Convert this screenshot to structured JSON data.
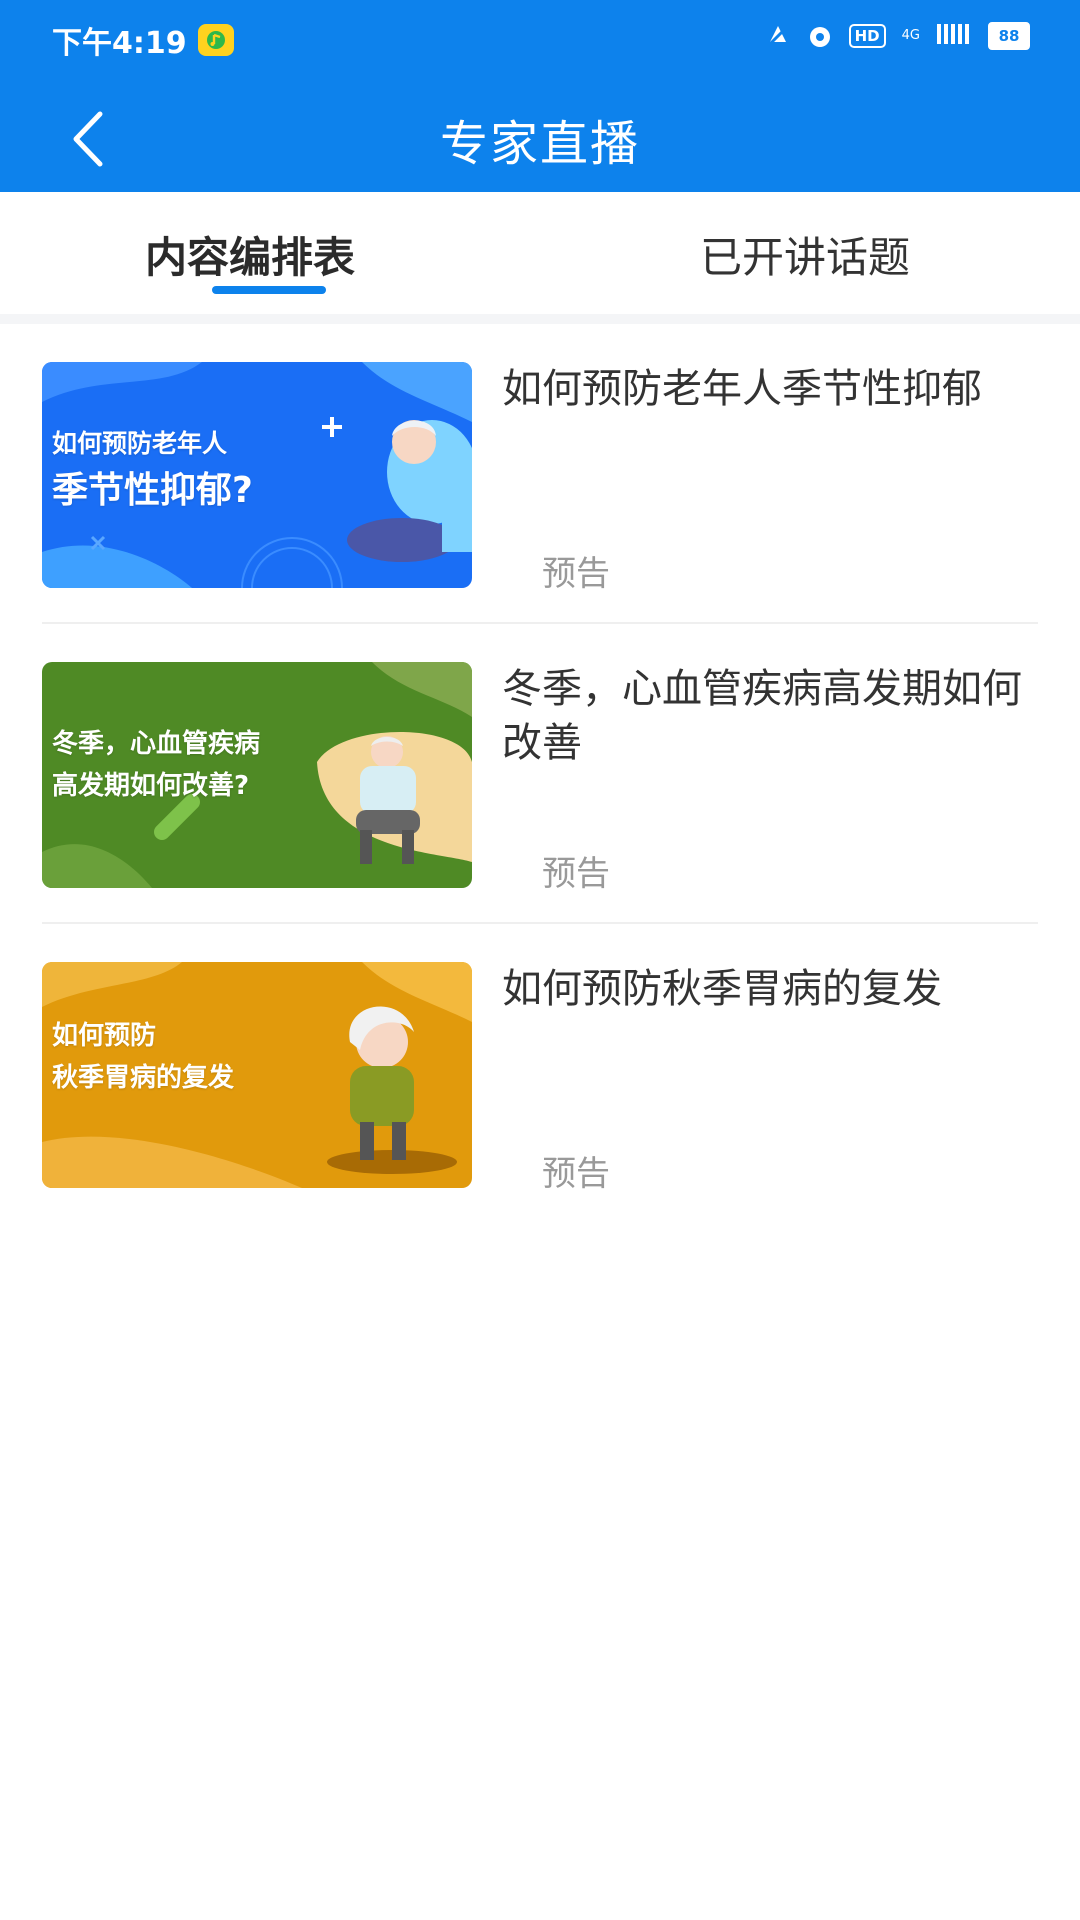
{
  "status_bar": {
    "time": "下午4:19",
    "hd": "HD",
    "network": "4G",
    "battery": "88"
  },
  "nav": {
    "title": "专家直播"
  },
  "tabs": [
    {
      "label": "内容编排表",
      "active": true
    },
    {
      "label": "已开讲话题",
      "active": false
    }
  ],
  "items": [
    {
      "thumb_line1": "如何预防老年人",
      "thumb_line2": "季节性抑郁?",
      "title": "如何预防老年人季节性抑郁",
      "status": "预告",
      "theme_color": "#1a6ef5"
    },
    {
      "thumb_line1": "冬季，心血管疾病",
      "thumb_line2": "高发期如何改善?",
      "title": "冬季，心血管疾病高发期如何改善",
      "status": "预告",
      "theme_color": "#4f8a25"
    },
    {
      "thumb_line1": "如何预防",
      "thumb_line2": "秋季胃病的复发",
      "title": "如何预防秋季胃病的复发",
      "status": "预告",
      "theme_color": "#e19a0c"
    }
  ],
  "colors": {
    "primary": "#0d82ec",
    "title_text": "#333333",
    "muted_text": "#999999"
  }
}
